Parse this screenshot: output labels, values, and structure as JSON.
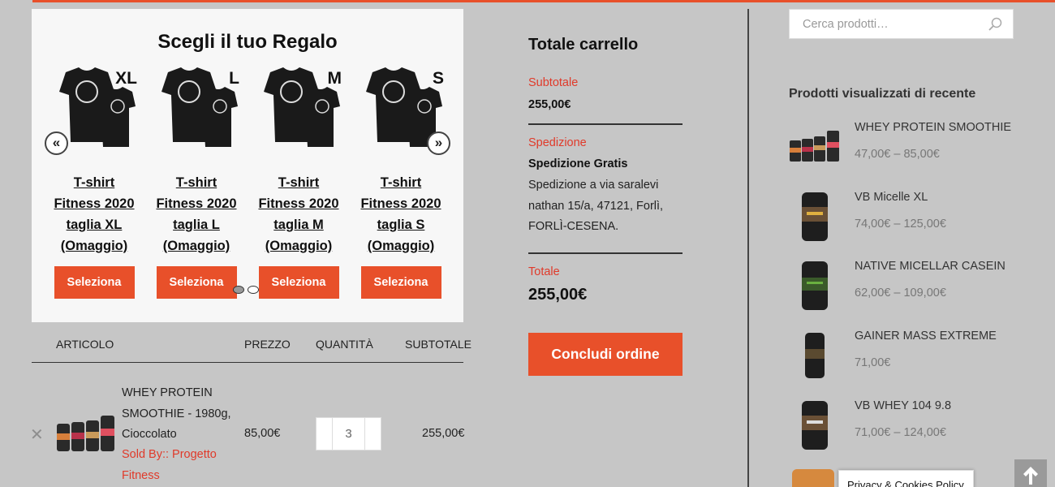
{
  "gift": {
    "title": "Scegli il tuo Regalo",
    "prev_label": "«",
    "next_label": "»",
    "items": [
      {
        "size": "XL",
        "name": "T-shirt Fitness 2020 taglia XL (Omaggio)",
        "button": "Seleziona"
      },
      {
        "size": "L",
        "name": "T-shirt Fitness 2020 taglia L (Omaggio)",
        "button": "Seleziona"
      },
      {
        "size": "M",
        "name": "T-shirt Fitness 2020 taglia M (Omaggio)",
        "button": "Seleziona"
      },
      {
        "size": "S",
        "name": "T-shirt Fitness 2020 taglia S (Omaggio)",
        "button": "Seleziona"
      }
    ],
    "dots": 2,
    "active_dot": 0
  },
  "cart": {
    "headers": {
      "article": "ARTICOLO",
      "price": "PREZZO",
      "quantity": "QUANTITÀ",
      "subtotal": "SUBTOTALE"
    },
    "items": [
      {
        "remove": "✕",
        "name": "WHEY PROTEIN SMOOTHIE - 1980g, Cioccolato",
        "sold_by": "Sold By:: Progetto Fitness",
        "price": "85,00€",
        "quantity": "3",
        "subtotal": "255,00€"
      }
    ]
  },
  "totals": {
    "title": "Totale carrello",
    "subtotal_label": "Subtotale",
    "subtotal_value": "255,00€",
    "shipping_label": "Spedizione",
    "shipping_value": "Spedizione Gratis",
    "shipping_address": "Spedizione a via saralevi nathan 15/a, 47121, Forlì, FORLÌ-CESENA.",
    "total_label": "Totale",
    "total_value": "255,00€",
    "checkout": "Concludi ordine"
  },
  "sidebar": {
    "search_placeholder": "Cerca prodotti…",
    "recent_title": "Prodotti visualizzati di recente",
    "recent": [
      {
        "name": "WHEY PROTEIN SMOOTHIE",
        "price": "47,00€ – 85,00€"
      },
      {
        "name": "VB Micelle XL",
        "price": "74,00€ – 125,00€"
      },
      {
        "name": "NATIVE MICELLAR CASEIN",
        "price": "62,00€ – 109,00€"
      },
      {
        "name": "GAINER MASS EXTREME",
        "price": "71,00€"
      },
      {
        "name": "VB WHEY 104 9.8",
        "price": "71,00€ – 124,00€"
      }
    ]
  },
  "cookie_notice": "Privacy & Cookies Policy",
  "colors": {
    "accent": "#e8502a",
    "label_red": "#e03a2a",
    "background": "#c6c6c6"
  },
  "icons": {
    "search": "search-icon",
    "back_to_top": "arrow-up-icon"
  }
}
